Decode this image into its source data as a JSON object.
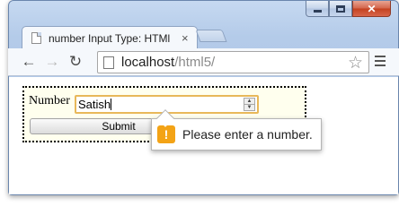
{
  "browser": {
    "tab_title": "number Input Type: HTMl",
    "tab_close": "×",
    "url_host": "localhost",
    "url_path": "/html5/",
    "window_controls": {
      "close_glyph": "✕"
    },
    "icons": {
      "back": "back-arrow-icon",
      "forward": "forward-arrow-icon",
      "reload": "reload-icon",
      "star": "bookmark-star-icon",
      "menu": "menu-icon"
    }
  },
  "form": {
    "label": "Number",
    "input_value": "Satish",
    "submit_label": "Submit"
  },
  "validation": {
    "message": "Please enter a number.",
    "icon_glyph": "!",
    "accent_color": "#f3a316"
  }
}
